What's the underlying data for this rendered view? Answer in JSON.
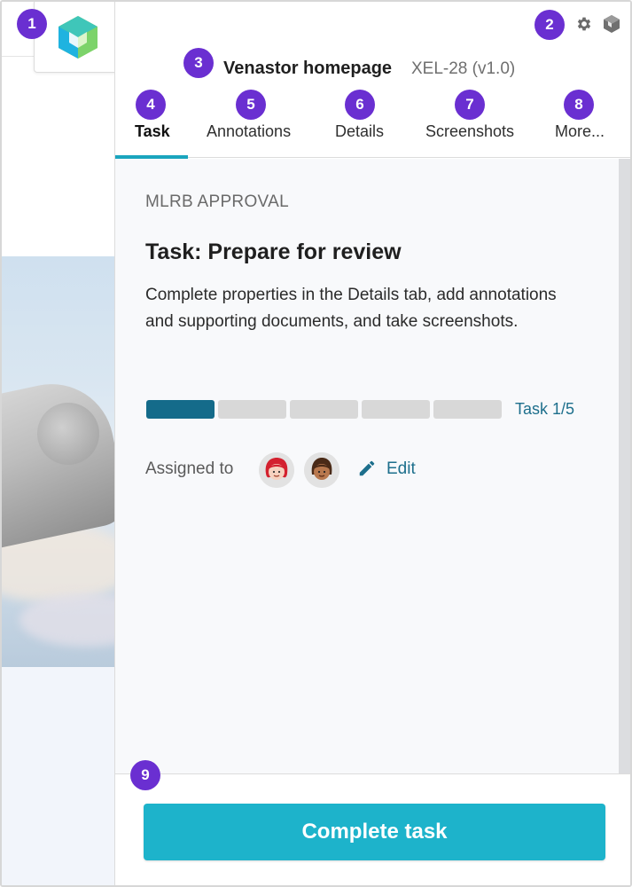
{
  "document": {
    "title": "Venastor homepage",
    "id": "XEL-28 (v1.0)"
  },
  "tabs": [
    {
      "label": "Task",
      "active": true
    },
    {
      "label": "Annotations",
      "active": false
    },
    {
      "label": "Details",
      "active": false
    },
    {
      "label": "Screenshots",
      "active": false
    },
    {
      "label": "More...",
      "active": false
    }
  ],
  "task": {
    "section": "MLRB APPROVAL",
    "title": "Task: Prepare for review",
    "description": "Complete properties in the Details tab, add annotations and supporting documents, and take screenshots.",
    "progress_text": "Task 1/5",
    "progress_current": 1,
    "progress_total": 5,
    "assigned_label": "Assigned to",
    "edit_label": "Edit"
  },
  "assignees": [
    {
      "name": "assignee-1",
      "hair_color": "#d3212f",
      "skin_color": "#f6d2bf"
    },
    {
      "name": "assignee-2",
      "hair_color": "#4a2a17",
      "skin_color": "#b8784e"
    }
  ],
  "footer": {
    "complete_label": "Complete task"
  },
  "callouts": [
    "1",
    "2",
    "3",
    "4",
    "5",
    "6",
    "7",
    "8",
    "9"
  ],
  "icons": {
    "logo": "app-logo-icon",
    "settings": "gear-icon",
    "cube": "cube-icon",
    "edit": "pencil-icon"
  },
  "colors": {
    "accent": "#1db3cb",
    "link": "#1d6f8c",
    "progress_done": "#146b8a",
    "badge": "#6a2fd1"
  }
}
